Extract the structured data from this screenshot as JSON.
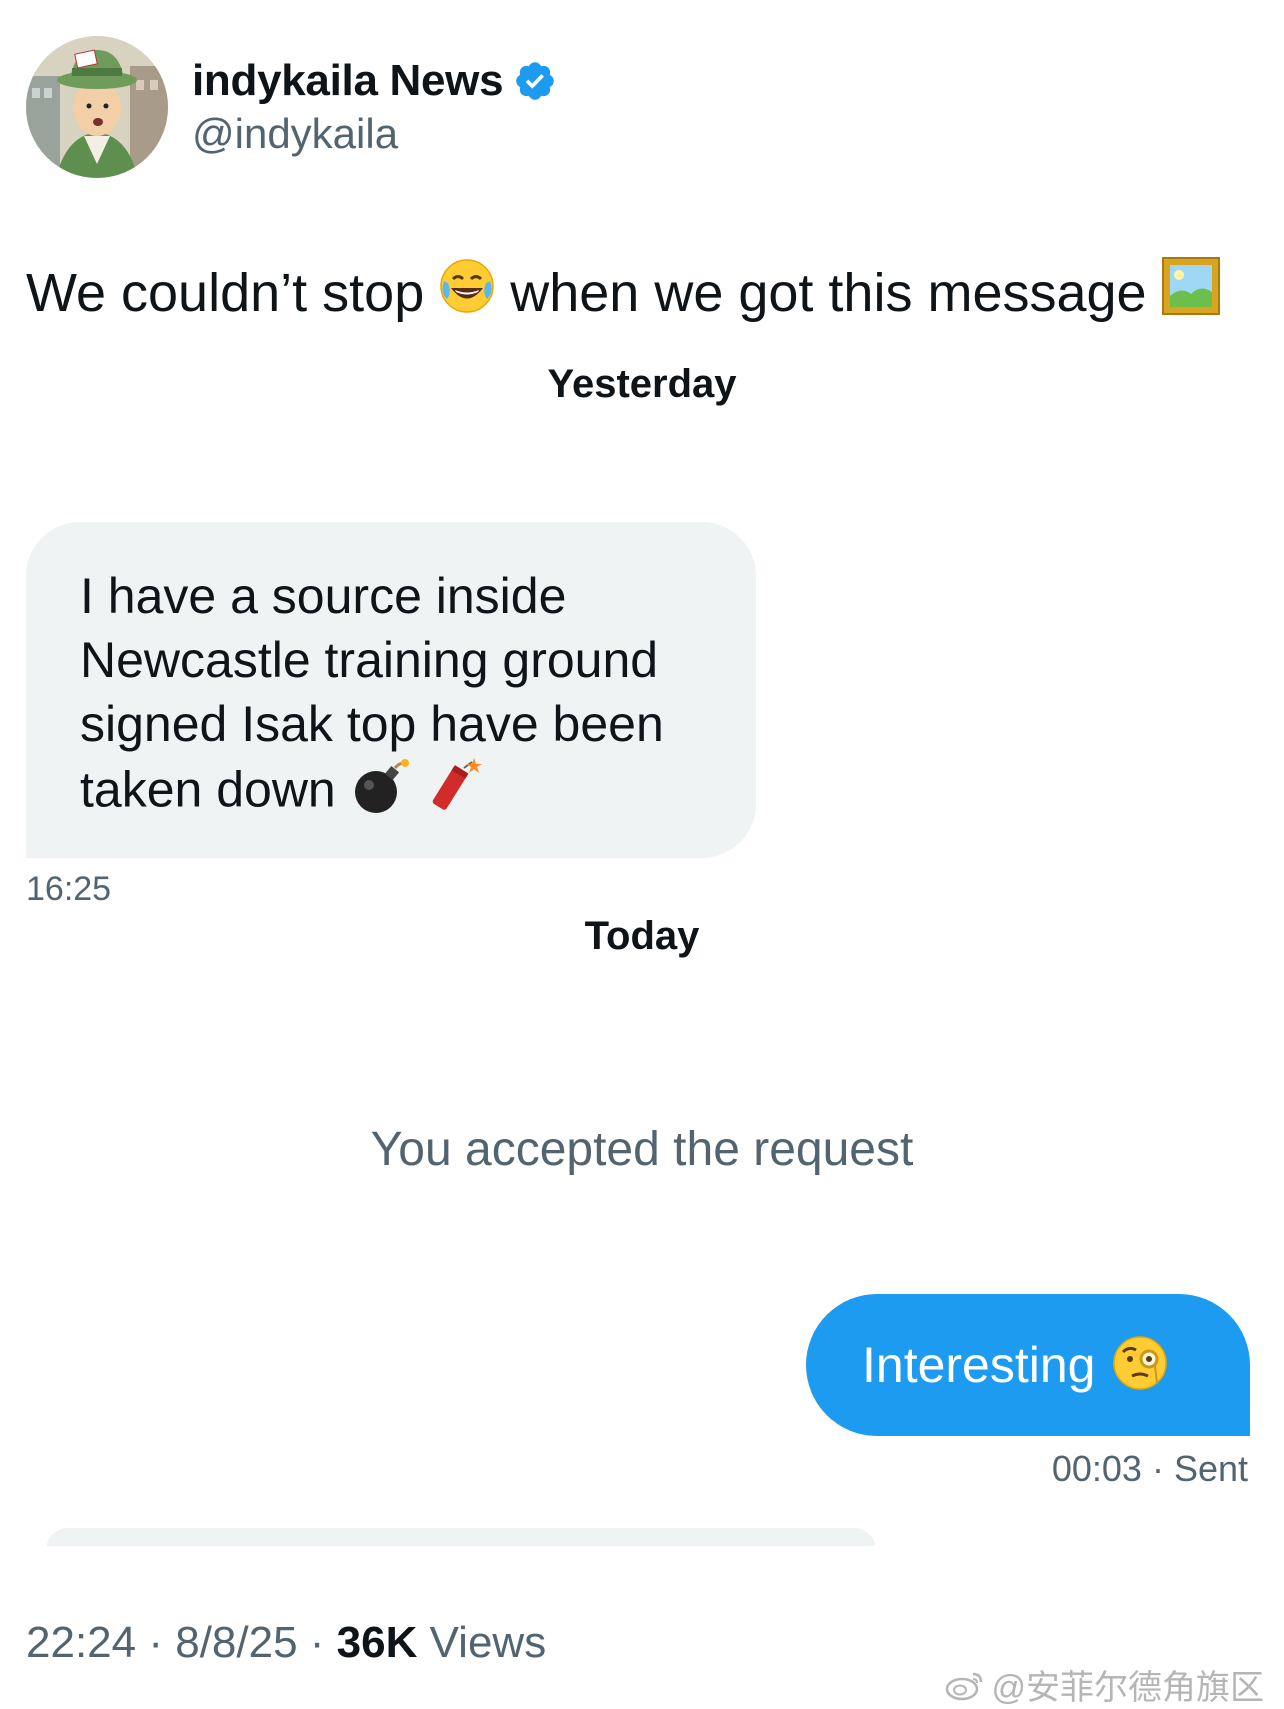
{
  "header": {
    "display_name": "indykaila News",
    "handle": "@indykaila",
    "verified_icon": "verified-badge-icon",
    "avatar_icon": "avatar-illustration"
  },
  "tweet": {
    "text_part1": "We couldn’t stop",
    "emoji1": "face-with-tears-of-joy-icon",
    "text_part2": "when we got this message",
    "emoji2": "framed-picture-icon"
  },
  "conversation": {
    "day1_label": "Yesterday",
    "incoming_message": {
      "text": "I have a source inside Newcastle training ground signed Isak top have been taken down",
      "emojis": [
        "bomb-icon",
        "firecracker-icon"
      ],
      "time": "16:25"
    },
    "day2_label": "Today",
    "system_message": "You accepted the request",
    "outgoing_message": {
      "text": "Interesting",
      "emoji": "face-with-monocle-icon",
      "time": "00:03",
      "status": "Sent",
      "separator": " · "
    }
  },
  "meta": {
    "time": "22:24",
    "date": "8/8/25",
    "views_count": "36K",
    "views_label": "Views",
    "separator": " · "
  },
  "watermark": {
    "text": "@安菲尔德角旗区",
    "icon": "weibo-icon"
  },
  "colors": {
    "accent": "#1d9bf0",
    "text_primary": "#0f1419",
    "text_secondary": "#536471",
    "bubble_incoming": "#eff3f4"
  }
}
